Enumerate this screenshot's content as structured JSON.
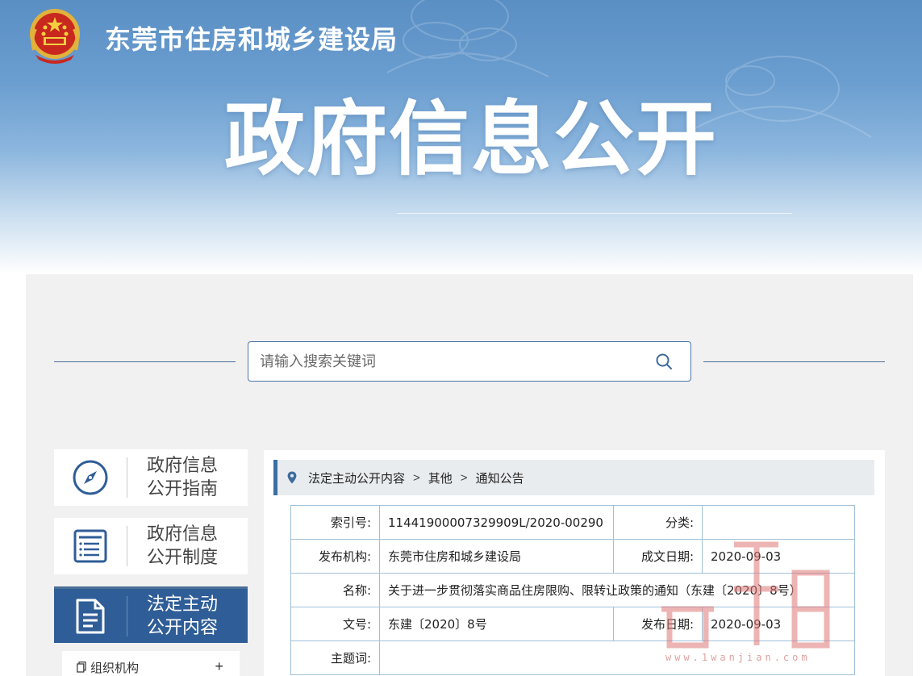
{
  "header": {
    "org_name": "东莞市住房和城乡建设局",
    "big_title": "政府信息公开"
  },
  "search": {
    "placeholder": "请输入搜索关键词",
    "icon": "search-icon"
  },
  "nav": {
    "items": [
      {
        "line1": "政府信息",
        "line2": "公开指南",
        "icon": "compass-icon",
        "active": false
      },
      {
        "line1": "政府信息",
        "line2": "公开制度",
        "icon": "list-document-icon",
        "active": false
      },
      {
        "line1": "法定主动",
        "line2": "公开内容",
        "icon": "file-document-icon",
        "active": true
      }
    ],
    "sub_item": {
      "label": "组织机构",
      "expand": "+"
    }
  },
  "breadcrumb": {
    "items": [
      "法定主动公开内容",
      "其他",
      "通知公告"
    ],
    "separator": ">"
  },
  "meta": {
    "index_label": "索引号:",
    "index_value": "11441900007329909L/2020-00290",
    "category_label": "分类:",
    "category_value": "",
    "publisher_label": "发布机构:",
    "publisher_value": "东莞市住房和城乡建设局",
    "date_written_label": "成文日期:",
    "date_written_value": "2020-09-03",
    "name_label": "名称:",
    "name_value": "关于进一步贯彻落实商品住房限购、限转让政策的通知（东建〔2020〕8号）",
    "doc_no_label": "文号:",
    "doc_no_value": "东建〔2020〕8号",
    "publish_date_label": "发布日期:",
    "publish_date_value": "2020-09-03",
    "topic_label": "主题词:",
    "topic_value": ""
  },
  "watermark": {
    "text": "www.1wanjian.com"
  },
  "colors": {
    "accent": "#2f5d97",
    "banner_top": "#5a8fc4",
    "table_border": "#9fc0d8"
  }
}
